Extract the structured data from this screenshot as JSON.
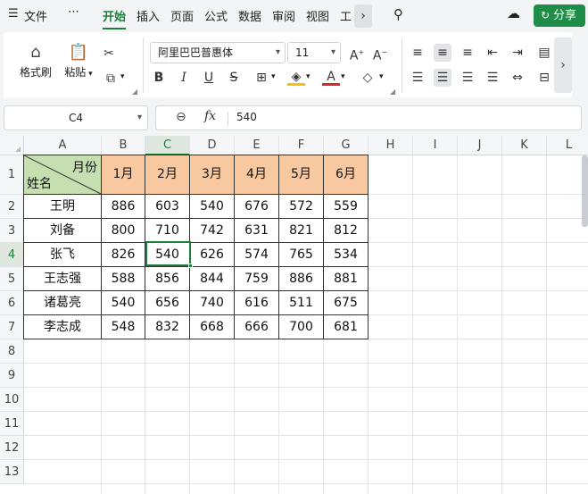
{
  "menu": {
    "file_icon": "hamburger-icon",
    "file": "文件",
    "more": "⋯",
    "tabs": [
      "开始",
      "插入",
      "页面",
      "公式",
      "数据",
      "审阅",
      "视图",
      "工"
    ],
    "active_tab": "开始",
    "share": "分享"
  },
  "ribbon": {
    "format_painter": "格式刷",
    "paste": "粘贴",
    "font_name": "阿里巴巴普惠体",
    "font_size": "11",
    "bold": "B",
    "italic": "I",
    "underline": "U",
    "strikethrough": "S"
  },
  "formula_bar": {
    "name_box": "C4",
    "fx": "fx",
    "value": "540"
  },
  "sheet": {
    "columns": [
      "A",
      "B",
      "C",
      "D",
      "E",
      "F",
      "G",
      "H",
      "I",
      "J",
      "K",
      "L"
    ],
    "rows": [
      "1",
      "2",
      "3",
      "4",
      "5",
      "6",
      "7",
      "8",
      "9",
      "10",
      "11",
      "12",
      "13"
    ],
    "selected_column": "C",
    "selected_row": "4",
    "header_diag_top": "月份",
    "header_diag_bottom": "姓名",
    "months": [
      "1月",
      "2月",
      "3月",
      "4月",
      "5月",
      "6月"
    ],
    "data": [
      [
        "王明",
        "886",
        "603",
        "540",
        "676",
        "572",
        "559"
      ],
      [
        "刘备",
        "800",
        "710",
        "742",
        "631",
        "821",
        "812"
      ],
      [
        "张飞",
        "826",
        "540",
        "626",
        "574",
        "765",
        "534"
      ],
      [
        "王志强",
        "588",
        "856",
        "844",
        "759",
        "886",
        "881"
      ],
      [
        "诸葛亮",
        "540",
        "656",
        "740",
        "616",
        "511",
        "675"
      ],
      [
        "李志成",
        "548",
        "832",
        "668",
        "666",
        "700",
        "681"
      ]
    ]
  },
  "colors": {
    "accent": "#1e7d3a",
    "header_fill": "#f8c9a0",
    "diag_fill": "#c5dfb0"
  }
}
